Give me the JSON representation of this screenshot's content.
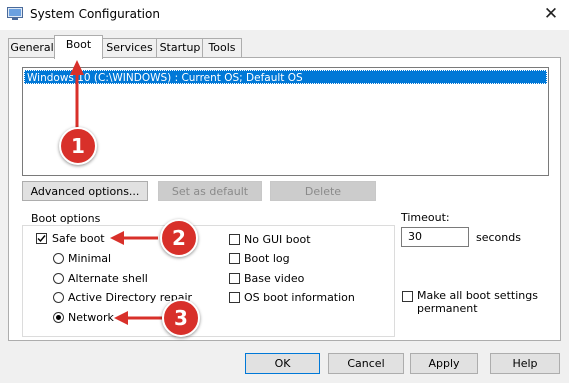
{
  "window": {
    "title": "System Configuration",
    "close_glyph": "✕"
  },
  "tabs": [
    {
      "label": "General"
    },
    {
      "label": "Boot"
    },
    {
      "label": "Services"
    },
    {
      "label": "Startup"
    },
    {
      "label": "Tools"
    }
  ],
  "os_list": {
    "items": [
      "Windows 10 (C:\\WINDOWS) : Current OS; Default OS"
    ]
  },
  "os_buttons": {
    "advanced": "Advanced options...",
    "set_default": "Set as default",
    "delete": "Delete"
  },
  "boot_options": {
    "label": "Boot options",
    "safe_boot": {
      "label": "Safe boot",
      "checked": true
    },
    "minimal": {
      "label": "Minimal",
      "selected": false
    },
    "alternate_shell": {
      "label": "Alternate shell",
      "selected": false
    },
    "ad_repair": {
      "label": "Active Directory repair",
      "selected": false
    },
    "network": {
      "label": "Network",
      "selected": true
    },
    "no_gui_boot": {
      "label": "No GUI boot",
      "checked": false
    },
    "boot_log": {
      "label": "Boot log",
      "checked": false
    },
    "base_video": {
      "label": "Base video",
      "checked": false
    },
    "os_boot_info": {
      "label": "OS boot information",
      "checked": false
    }
  },
  "timeout": {
    "label": "Timeout:",
    "value": "30",
    "unit": "seconds"
  },
  "make_permanent": {
    "label_line1": "Make all boot settings",
    "label_line2": "permanent",
    "checked": false
  },
  "footer": {
    "ok": "OK",
    "cancel": "Cancel",
    "apply": "Apply",
    "help": "Help"
  },
  "annotations": {
    "badge1": "1",
    "badge2": "2",
    "badge3": "3",
    "color": "#d8302a"
  }
}
